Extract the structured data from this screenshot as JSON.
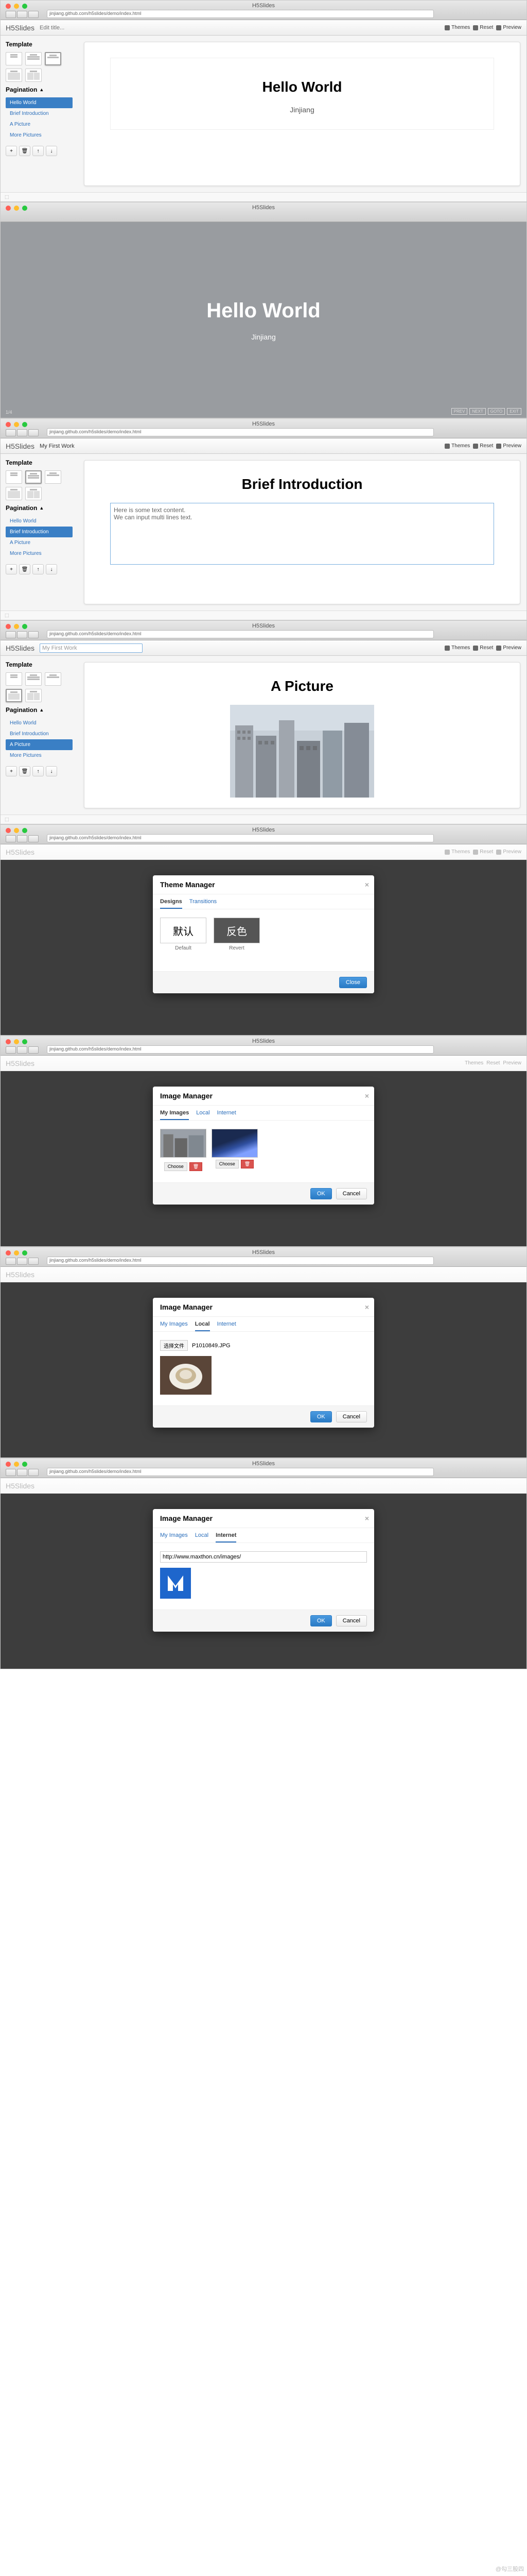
{
  "browser": {
    "title": "H5Slides",
    "url": "jinjiang.github.com/h5slides/demo/index.html"
  },
  "app": {
    "logo": "H5Slides",
    "title_placeholder": "Edit title...",
    "title_value": "My First Work",
    "actions": {
      "themes": "Themes",
      "reset": "Reset",
      "preview": "Preview"
    }
  },
  "sidebar": {
    "template_label": "Template",
    "pagination_label": "Pagination",
    "pages": [
      "Hello World",
      "Brief Introduction",
      "A Picture",
      "More Pictures"
    ]
  },
  "slides": {
    "hello": {
      "title": "Hello World",
      "subtitle": "Jinjiang"
    },
    "brief": {
      "title": "Brief Introduction",
      "line1": "Here is some text content.",
      "line2": "We can input multi lines text."
    },
    "picture": {
      "title": "A Picture"
    }
  },
  "presentation": {
    "counter": "1/4",
    "nav": [
      "PREV",
      "NEXT",
      "GOTO",
      "EXIT"
    ]
  },
  "theme_modal": {
    "title": "Theme Manager",
    "tabs": [
      "Designs",
      "Transitions"
    ],
    "themes": [
      {
        "preview": "默认",
        "name": "Default"
      },
      {
        "preview": "反色",
        "name": "Revert"
      }
    ],
    "close": "Close"
  },
  "image_modal": {
    "title": "Image Manager",
    "tabs": [
      "My Images",
      "Local",
      "Internet"
    ],
    "choose": "Choose",
    "upload_label": "选择文件",
    "filename": "P1010849.JPG",
    "url_value": "http://www.maxthon.cn/images/",
    "ok": "OK",
    "cancel": "Cancel"
  },
  "watermark": "@勾三股四"
}
